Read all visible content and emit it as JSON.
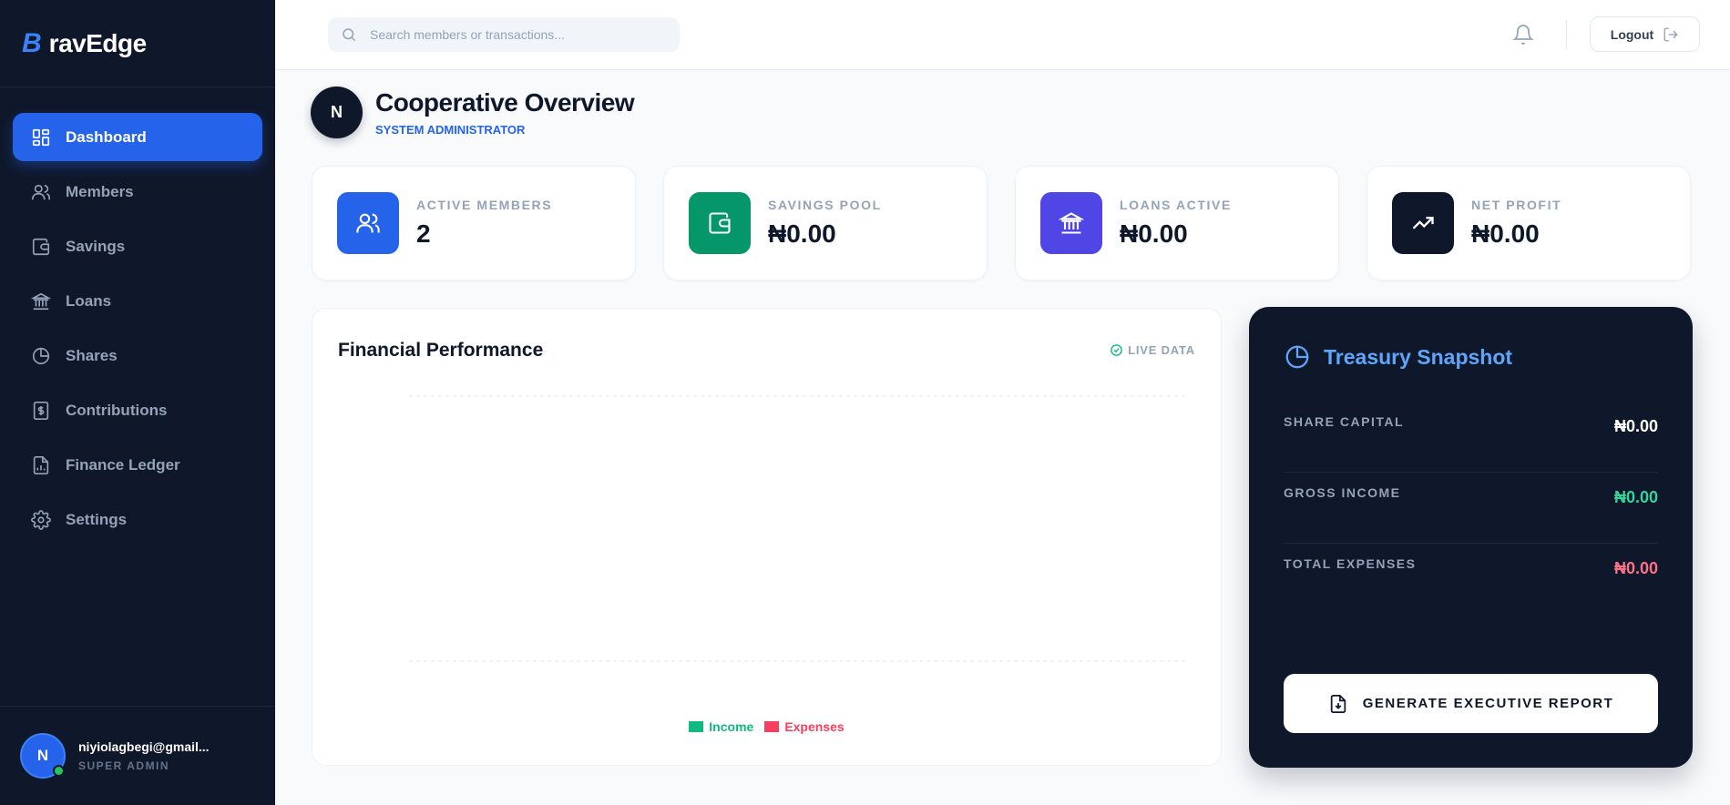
{
  "brand": {
    "mark": "B",
    "name": "ravEdge"
  },
  "sidebar": {
    "items": [
      {
        "label": "Dashboard",
        "icon": "dashboard-icon",
        "active": true
      },
      {
        "label": "Members",
        "icon": "users-icon"
      },
      {
        "label": "Savings",
        "icon": "wallet-icon"
      },
      {
        "label": "Loans",
        "icon": "bank-icon"
      },
      {
        "label": "Shares",
        "icon": "pie-chart-icon"
      },
      {
        "label": "Contributions",
        "icon": "receipt-icon"
      },
      {
        "label": "Finance Ledger",
        "icon": "file-chart-icon"
      },
      {
        "label": "Settings",
        "icon": "gear-icon"
      }
    ],
    "user": {
      "initial": "N",
      "email": "niyiolagbegi@gmail...",
      "role": "SUPER ADMIN"
    }
  },
  "topbar": {
    "search_placeholder": "Search members or transactions...",
    "logout_label": "Logout"
  },
  "header": {
    "avatar_initial": "N",
    "title": "Cooperative Overview",
    "subtitle": "SYSTEM ADMINISTRATOR"
  },
  "stats": [
    {
      "label": "ACTIVE MEMBERS",
      "value": "2",
      "color": "#2563eb",
      "icon": "users-icon"
    },
    {
      "label": "SAVINGS POOL",
      "value": "₦0.00",
      "color": "#059669",
      "icon": "wallet-icon"
    },
    {
      "label": "LOANS ACTIVE",
      "value": "₦0.00",
      "color": "#4f46e5",
      "icon": "bank-icon"
    },
    {
      "label": "NET PROFIT",
      "value": "₦0.00",
      "color": "#0f172a",
      "icon": "trending-up-icon"
    }
  ],
  "performance": {
    "title": "Financial Performance",
    "live_label": "LIVE DATA"
  },
  "chart_data": {
    "type": "bar",
    "title": "Financial Performance",
    "categories": [],
    "series": [
      {
        "name": "Income",
        "values": [],
        "color": "#10b981"
      },
      {
        "name": "Expenses",
        "values": [],
        "color": "#f43f5e"
      }
    ],
    "grid": true,
    "legend": "bottom-center"
  },
  "treasury": {
    "title": "Treasury Snapshot",
    "rows": [
      {
        "label": "SHARE CAPITAL",
        "value": "₦0.00",
        "color": "#ffffff"
      },
      {
        "label": "GROSS INCOME",
        "value": "₦0.00",
        "color": "#34d399"
      },
      {
        "label": "TOTAL EXPENSES",
        "value": "₦0.00",
        "color": "#fb7185"
      }
    ],
    "report_label": "GENERATE EXECUTIVE REPORT"
  }
}
